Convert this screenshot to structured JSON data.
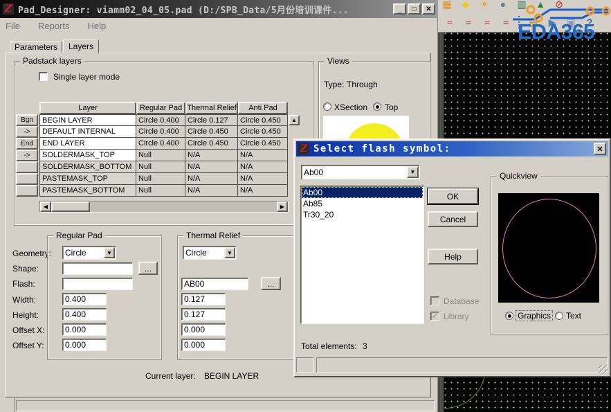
{
  "colors": {
    "window_chrome": "#d4d0c8",
    "main_titlebar_gradient": [
      "#0b0b0b",
      "#9c9c9c"
    ],
    "dialog_titlebar_gradient": [
      "#0b2fa6",
      "#8aa8da"
    ],
    "selection_blue": "#0a246a",
    "pad_preview_yellow": "#f2ee1e",
    "flash_circle_pink": "#e87fc0",
    "logo_blue": "#2268c4",
    "canvas_black": "#010301"
  },
  "icons": {
    "app_glyph": "Z",
    "minimize": "_",
    "maximize": "□",
    "close": "✕",
    "dropdown": "▼",
    "up": "▲",
    "left": "◀",
    "right": "▶",
    "check": "✓",
    "more": "..."
  },
  "background": {
    "logo_text": "EDA365",
    "toolbar_row1": [
      "▦",
      "◆",
      "☀",
      "●",
      "▥",
      "▲",
      "⊘"
    ],
    "toolbar_row2": [
      "≈",
      "≈",
      "≈",
      "≈",
      "▤",
      "▶",
      "▣",
      "?"
    ]
  },
  "main": {
    "title": "Pad_Designer: viamm02_04_05.pad (D:/SPB_Data/5月份培训课件...",
    "menu": [
      "File",
      "Reports",
      "Help"
    ],
    "tabs": [
      "Parameters",
      "Layers"
    ],
    "active_tab": "Layers",
    "padstack": {
      "label": "Padstack layers",
      "single_layer_mode": "Single layer mode",
      "columns": [
        "Layer",
        "Regular Pad",
        "Thermal Relief",
        "Anti Pad"
      ],
      "rows": [
        {
          "tag": "Bgn",
          "layer": "BEGIN LAYER",
          "regular": "Circle 0.400",
          "thermal": "Circle 0.127",
          "anti": "Circle 0.450"
        },
        {
          "tag": "->",
          "layer": "DEFAULT INTERNAL",
          "regular": "Circle 0.400",
          "thermal": "Circle 0.450",
          "anti": "Circle 0.450"
        },
        {
          "tag": "End",
          "layer": "END LAYER",
          "regular": "Circle 0.400",
          "thermal": "Circle 0.450",
          "anti": "Circle 0.450"
        },
        {
          "tag": "->",
          "layer": "SOLDERMASK_TOP",
          "regular": "Null",
          "thermal": "N/A",
          "anti": "N/A"
        },
        {
          "tag": "",
          "layer": "SOLDERMASK_BOTTOM",
          "regular": "Null",
          "thermal": "N/A",
          "anti": "N/A"
        },
        {
          "tag": "",
          "layer": "PASTEMASK_TOP",
          "regular": "Null",
          "thermal": "N/A",
          "anti": "N/A"
        },
        {
          "tag": "",
          "layer": "PASTEMASK_BOTTOM",
          "regular": "Null",
          "thermal": "N/A",
          "anti": "N/A"
        }
      ]
    },
    "views": {
      "label": "Views",
      "type_label": "Type:",
      "type_value": "Through",
      "radio_xsection": "XSection",
      "radio_top": "Top",
      "selected": "Top"
    },
    "regular_pad": {
      "label": "Regular Pad",
      "geometry_label": "Geometry:",
      "geometry_value": "Circle",
      "shape_label": "Shape:",
      "shape_value": "",
      "flash_label": "Flash:",
      "flash_value": "",
      "width_label": "Width:",
      "width_value": "0.400",
      "height_label": "Height:",
      "height_value": "0.400",
      "offset_x_label": "Offset X:",
      "offset_x_value": "0.000",
      "offset_y_label": "Offset Y:",
      "offset_y_value": "0.000"
    },
    "thermal_relief": {
      "label": "Thermal Relief",
      "geometry_value": "Circle",
      "flash_value": "AB00",
      "width_value": "0.127",
      "height_value": "0.127",
      "offset_x_value": "0.000",
      "offset_y_value": "0.000"
    },
    "current_layer_label": "Current layer:",
    "current_layer_value": "BEGIN LAYER"
  },
  "dialog": {
    "title": "Select flash symbol:",
    "combo_value": "Ab00",
    "list_items": [
      "Ab00",
      "Ab85",
      "Tr30_20"
    ],
    "selected_item": "Ab00",
    "ok": "OK",
    "cancel": "Cancel",
    "help": "Help",
    "database_label": "Database",
    "library_label": "Library",
    "quickview_label": "Quickview",
    "radio_graphics": "Graphics",
    "radio_text": "Text",
    "selected_radio": "Graphics",
    "total_label": "Total elements:",
    "total_value": "3"
  }
}
